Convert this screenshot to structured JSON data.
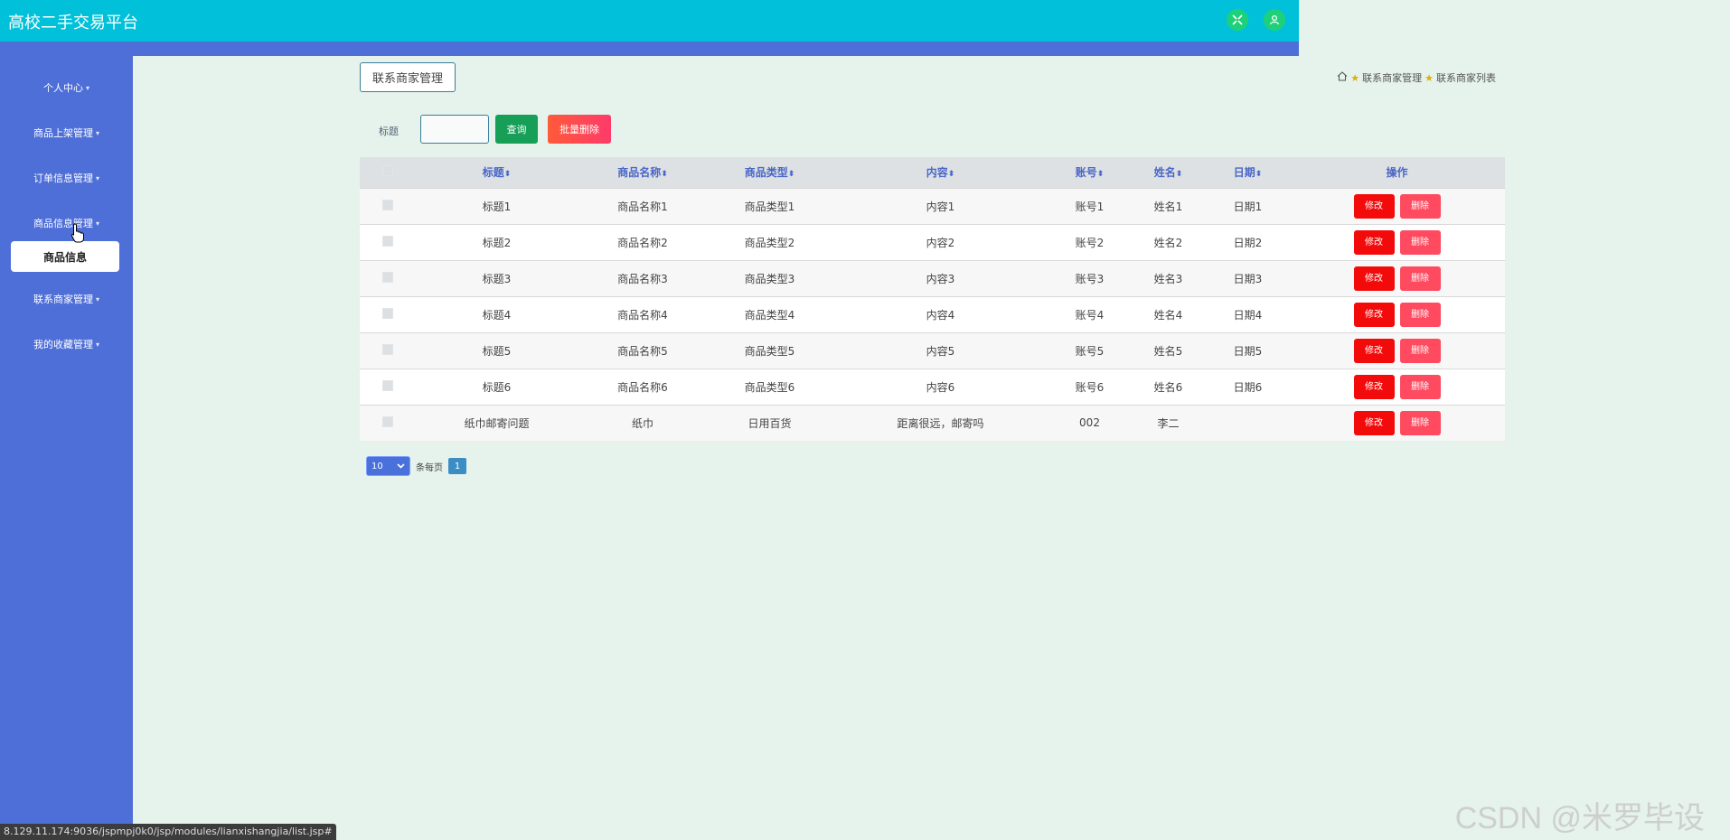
{
  "app": {
    "title": "高校二手交易平台"
  },
  "sidebar": {
    "items": [
      {
        "label": "个人中心"
      },
      {
        "label": "商品上架管理"
      },
      {
        "label": "订单信息管理"
      },
      {
        "label": "商品信息管理"
      },
      {
        "label": "联系商家管理"
      },
      {
        "label": "我的收藏管理"
      }
    ],
    "submenu": {
      "label": "商品信息"
    }
  },
  "main": {
    "section_label": "联系商家管理",
    "breadcrumb": [
      "联系商家管理",
      "联系商家列表"
    ],
    "search": {
      "label": "标题",
      "value": "",
      "query_button": "查询",
      "batch_delete_button": "批量删除"
    }
  },
  "table": {
    "headers": [
      "标题",
      "商品名称",
      "商品类型",
      "内容",
      "账号",
      "姓名",
      "日期",
      "操作"
    ],
    "rows": [
      [
        "标题1",
        "商品名称1",
        "商品类型1",
        "内容1",
        "账号1",
        "姓名1",
        "日期1"
      ],
      [
        "标题2",
        "商品名称2",
        "商品类型2",
        "内容2",
        "账号2",
        "姓名2",
        "日期2"
      ],
      [
        "标题3",
        "商品名称3",
        "商品类型3",
        "内容3",
        "账号3",
        "姓名3",
        "日期3"
      ],
      [
        "标题4",
        "商品名称4",
        "商品类型4",
        "内容4",
        "账号4",
        "姓名4",
        "日期4"
      ],
      [
        "标题5",
        "商品名称5",
        "商品类型5",
        "内容5",
        "账号5",
        "姓名5",
        "日期5"
      ],
      [
        "标题6",
        "商品名称6",
        "商品类型6",
        "内容6",
        "账号6",
        "姓名6",
        "日期6"
      ],
      [
        "纸巾邮寄问题",
        "纸巾",
        "日用百货",
        "距离很远，邮寄吗",
        "002",
        "李二",
        ""
      ]
    ],
    "edit_label": "修改",
    "delete_label": "删除"
  },
  "pagination": {
    "page_size": "10",
    "per_page_label": "条每页",
    "current_page": "1"
  },
  "statusbar": {
    "url": "8.129.11.174:9036/jspmpj0k0/jsp/modules/lianxishangjia/list.jsp#"
  },
  "watermark": {
    "text": "CSDN @米罗毕设"
  },
  "colors": {
    "header": "#00c1d9",
    "sidebar": "#4f6fd8",
    "background": "#e6f2ec",
    "query": "#179f58",
    "danger": "#f30b0b"
  },
  "icons": {
    "header_left": "expand-icon",
    "header_right": "user-icon",
    "breadcrumb_home": "home-icon",
    "breadcrumb_sep": "star-icon"
  }
}
